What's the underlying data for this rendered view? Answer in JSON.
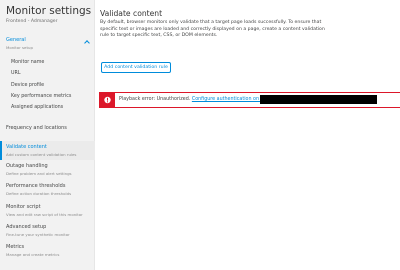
{
  "sidebar": {
    "title": "Monitor settings",
    "subtitle": "Frontend - Admanager",
    "general": {
      "label": "General",
      "desc": "Monitor setup"
    },
    "general_items": [
      "Monitor name",
      "URL",
      "Device profile",
      "Key performance metrics",
      "Assigned applications"
    ],
    "sections": [
      {
        "label": "Frequency and locations",
        "desc": ""
      },
      {
        "label": "Validate content",
        "desc": "Add custom content validation rules"
      },
      {
        "label": "Outage handling",
        "desc": "Define problem and alert settings"
      },
      {
        "label": "Performance thresholds",
        "desc": "Define action duration thresholds"
      },
      {
        "label": "Monitor script",
        "desc": "View and edit raw script of this monitor"
      },
      {
        "label": "Advanced setup",
        "desc": "Fine-tune your synthetic monitor"
      },
      {
        "label": "Metrics",
        "desc": "Manage and create metrics"
      }
    ]
  },
  "main": {
    "title": "Validate content",
    "description": "By default, browser monitors only validate that a target page loads successfully. To ensure that specific text or images are loaded and correctly displayed on a page, create a content validation rule to target specific text, CSS, or DOM elements.",
    "add_button": "Add content validation rule",
    "alert": {
      "message": "Playback error: Unauthorized. ",
      "link": "Configure authentication on site",
      "color": "#dc172a"
    }
  },
  "colors": {
    "accent": "#008cdb",
    "error": "#dc172a",
    "sidebar_bg": "#f2f2f2"
  }
}
